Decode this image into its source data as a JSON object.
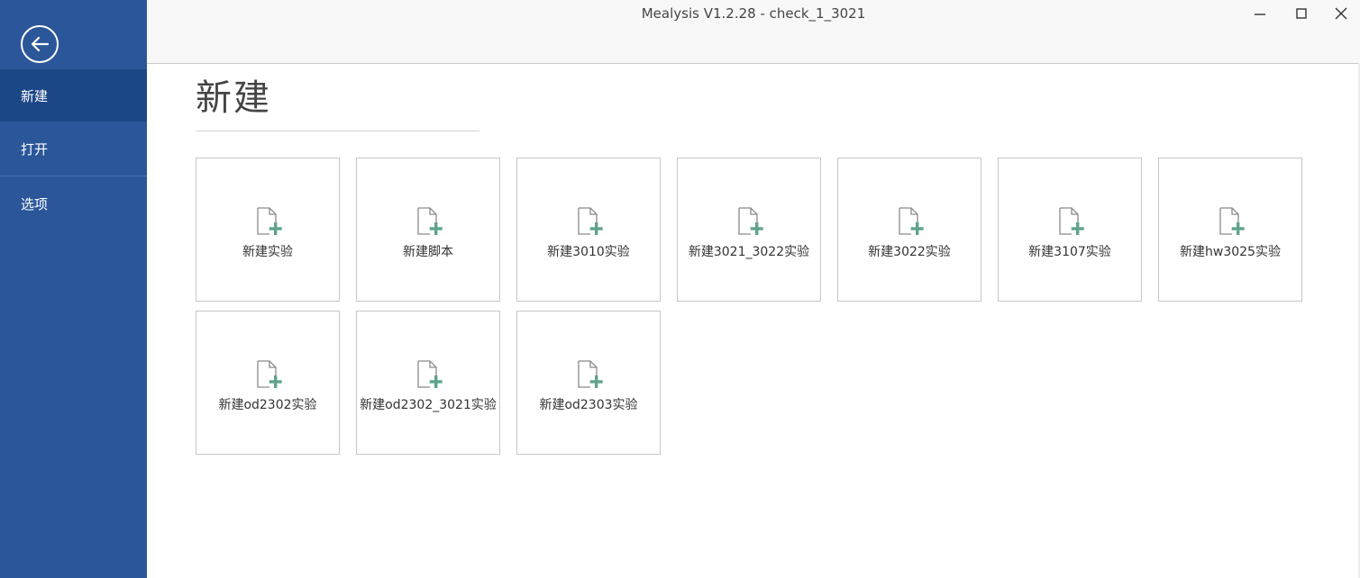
{
  "window": {
    "title": "Mealysis V1.2.28 - check_1_3021",
    "minimize_icon": "minimize-icon",
    "maximize_icon": "maximize-icon",
    "close_icon": "close-icon"
  },
  "sidebar": {
    "back_icon": "arrow-left-circle-icon",
    "items": [
      {
        "label": "新建",
        "active": true
      },
      {
        "label": "打开",
        "active": false
      },
      {
        "label": "选项",
        "active": false
      }
    ]
  },
  "main": {
    "title": "新建",
    "tile_icon": "new-document-plus-icon",
    "accent_color": "#5fa38a",
    "tiles": [
      {
        "label": "新建实验"
      },
      {
        "label": "新建脚本"
      },
      {
        "label": "新建3010实验"
      },
      {
        "label": "新建3021_3022实验"
      },
      {
        "label": "新建3022实验"
      },
      {
        "label": "新建3107实验"
      },
      {
        "label": "新建hw3025实验"
      },
      {
        "label": "新建od2302实验"
      },
      {
        "label": "新建od2302_3021实验"
      },
      {
        "label": "新建od2303实验"
      }
    ]
  }
}
